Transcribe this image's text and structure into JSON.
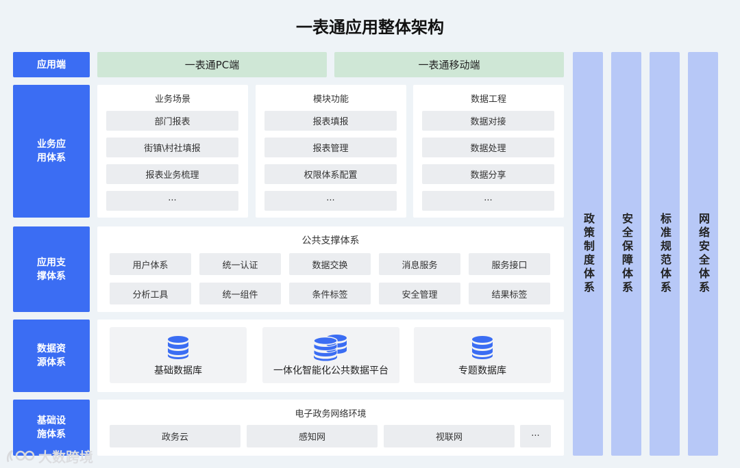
{
  "title": "一表通应用整体架构",
  "labels": {
    "app_end": "应用端",
    "business": "业务应用体系",
    "support": "应用支撑体系",
    "data": "数据资源体系",
    "infra": "基础设施体系"
  },
  "app_end": {
    "pc": "一表通PC端",
    "mobile": "一表通移动端"
  },
  "business": {
    "columns": [
      {
        "title": "业务场景",
        "items": [
          "部门报表",
          "街镇\\村社填报",
          "报表业务梳理",
          "···"
        ]
      },
      {
        "title": "模块功能",
        "items": [
          "报表填报",
          "报表管理",
          "权限体系配置",
          "···"
        ]
      },
      {
        "title": "数据工程",
        "items": [
          "数据对接",
          "数据处理",
          "数据分享",
          "···"
        ]
      }
    ]
  },
  "support": {
    "title": "公共支撑体系",
    "row1": [
      "用户体系",
      "统一认证",
      "数据交换",
      "消息服务",
      "服务接口"
    ],
    "row2": [
      "分析工具",
      "统一组件",
      "条件标签",
      "安全管理",
      "结果标签"
    ]
  },
  "data": {
    "cards": [
      "基础数据库",
      "一体化智能化公共数据平台",
      "专题数据库"
    ]
  },
  "infra": {
    "title": "电子政务网络环境",
    "items": [
      "政务云",
      "感知网",
      "视联网",
      "···"
    ]
  },
  "side_columns": [
    "政策制度体系",
    "安全保障体系",
    "标准规范体系",
    "网络安全体系"
  ],
  "watermark": "大数跨境",
  "colors": {
    "label_blue": "#3b6df3",
    "app_green": "#cfe7d6",
    "side_blue": "#b7c8f7",
    "pill_gray": "#ebedf0",
    "background": "#eef3f7"
  }
}
